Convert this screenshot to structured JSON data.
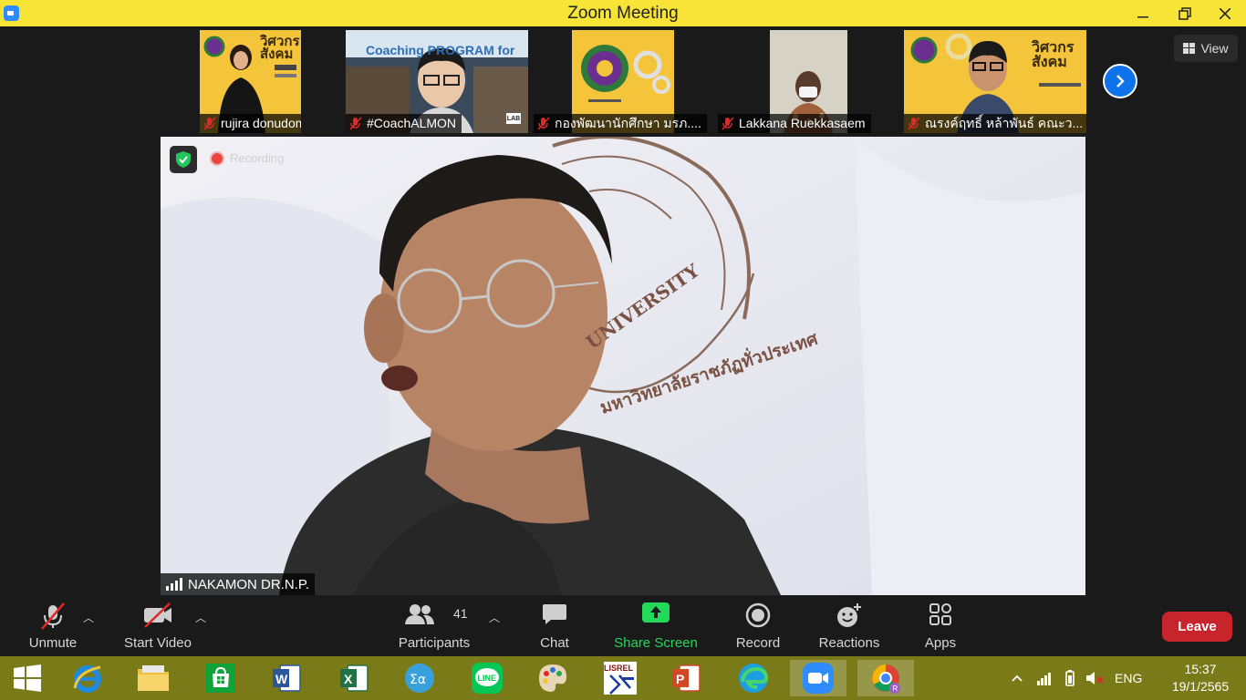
{
  "window": {
    "title": "Zoom Meeting"
  },
  "participants": [
    {
      "name": "rujira donudom",
      "poster_text": "วิศวกร สังคม"
    },
    {
      "name": "#CoachALMON",
      "poster_text": "Coaching PROGRAM for",
      "extra_text": "LAB"
    },
    {
      "name": "กองพัฒนานักศึกษา มรภ...."
    },
    {
      "name": "Lakkana Ruekkasaem"
    },
    {
      "name": "ณรงค์ฤทธิ์ หล้าพันธ์ คณะว...",
      "poster_text": "วิศวกร สังคม"
    }
  ],
  "view_label": "View",
  "main": {
    "recording_label": "Recording",
    "speaker_name": "NAKAMON DR.N.P.",
    "background_text_1": "UNIVERSITY",
    "background_text_2": "มหาวิทยาลัยราชภัฏทั่วประเทศ"
  },
  "toolbar": {
    "unmute": "Unmute",
    "start_video": "Start Video",
    "participants": "Participants",
    "participant_count": "41",
    "chat": "Chat",
    "share_screen": "Share Screen",
    "record": "Record",
    "reactions": "Reactions",
    "apps": "Apps",
    "leave": "Leave"
  },
  "taskbar": {
    "apps": [
      "start",
      "internet-explorer",
      "file-explorer",
      "store",
      "word",
      "excel",
      "math-input",
      "line",
      "paint",
      "lisrel",
      "powerpoint",
      "edge",
      "zoom",
      "chrome"
    ],
    "language": "ENG",
    "time": "15:37",
    "date": "19/1/2565"
  },
  "colors": {
    "titlebar": "#f7e436",
    "taskbar": "#7a7a18",
    "accent_blue": "#0e72ed",
    "share_green": "#23d959",
    "leave_red": "#c8242c",
    "mute_red": "#e02828"
  }
}
